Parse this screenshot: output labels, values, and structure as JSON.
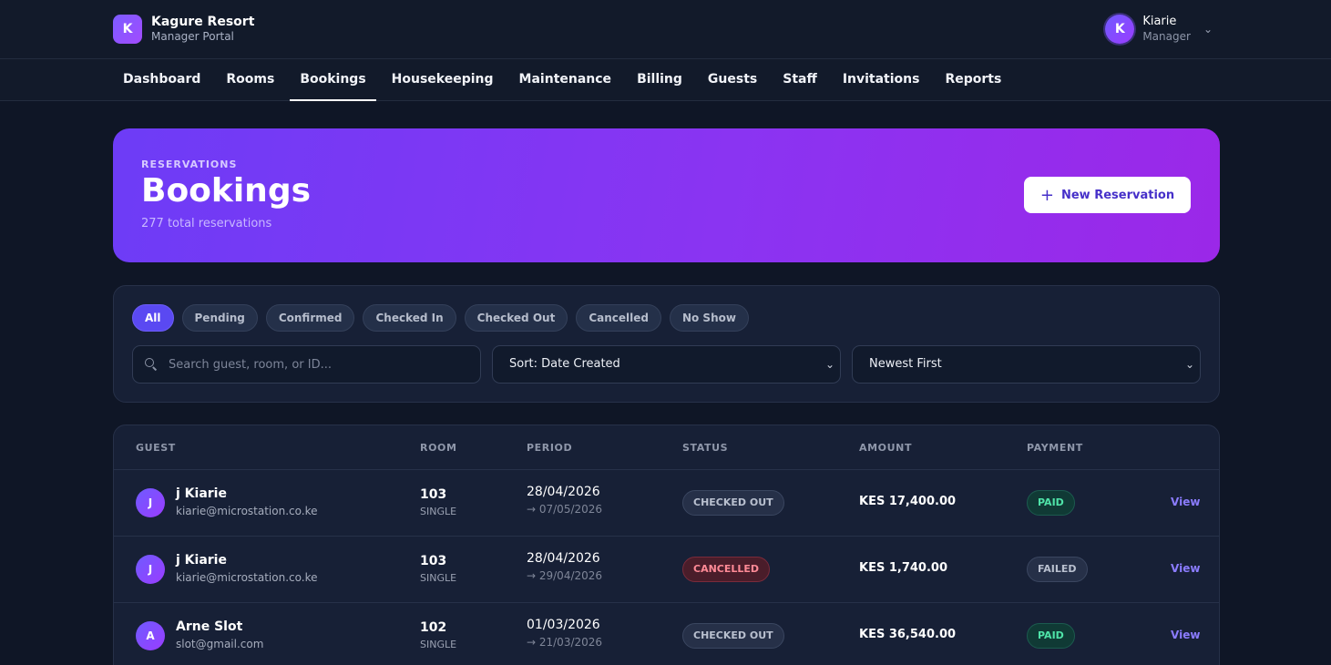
{
  "brand": {
    "logo_letter": "K",
    "name": "Kagure Resort",
    "subtitle": "Manager Portal"
  },
  "user": {
    "initial": "K",
    "name": "Kiarie",
    "role": "Manager"
  },
  "nav": {
    "items": [
      {
        "label": "Dashboard"
      },
      {
        "label": "Rooms"
      },
      {
        "label": "Bookings",
        "active": true
      },
      {
        "label": "Housekeeping"
      },
      {
        "label": "Maintenance"
      },
      {
        "label": "Billing"
      },
      {
        "label": "Guests"
      },
      {
        "label": "Staff"
      },
      {
        "label": "Invitations"
      },
      {
        "label": "Reports"
      }
    ]
  },
  "hero": {
    "eyebrow": "RESERVATIONS",
    "title": "Bookings",
    "subtitle": "277 total reservations",
    "button_label": "New Reservation"
  },
  "filters": {
    "chips": [
      "All",
      "Pending",
      "Confirmed",
      "Checked In",
      "Checked Out",
      "Cancelled",
      "No Show"
    ],
    "active_chip": "All",
    "search_placeholder": "Search guest, room, or ID...",
    "sort_value": "Sort: Date Created",
    "order_value": "Newest First"
  },
  "table": {
    "headers": {
      "guest": "GUEST",
      "room": "ROOM",
      "period": "PERIOD",
      "status": "STATUS",
      "amount": "AMOUNT",
      "payment": "PAYMENT"
    },
    "rows": [
      {
        "initial": "J",
        "name": "j Kiarie",
        "email": "kiarie@microstation.co.ke",
        "room": "103",
        "room_type": "SINGLE",
        "start": "28/04/2026",
        "end": "→ 07/05/2026",
        "status": "CHECKED OUT",
        "amount": "KES 17,400.00",
        "payment": "PAID",
        "action": "View"
      },
      {
        "initial": "J",
        "name": "j Kiarie",
        "email": "kiarie@microstation.co.ke",
        "room": "103",
        "room_type": "SINGLE",
        "start": "28/04/2026",
        "end": "→ 29/04/2026",
        "status": "CANCELLED",
        "amount": "KES 1,740.00",
        "payment": "FAILED",
        "action": "View"
      },
      {
        "initial": "A",
        "name": "Arne Slot",
        "email": "slot@gmail.com",
        "room": "102",
        "room_type": "SINGLE",
        "start": "01/03/2026",
        "end": "→ 21/03/2026",
        "status": "CHECKED OUT",
        "amount": "KES 36,540.00",
        "payment": "PAID",
        "action": "View"
      }
    ]
  }
}
